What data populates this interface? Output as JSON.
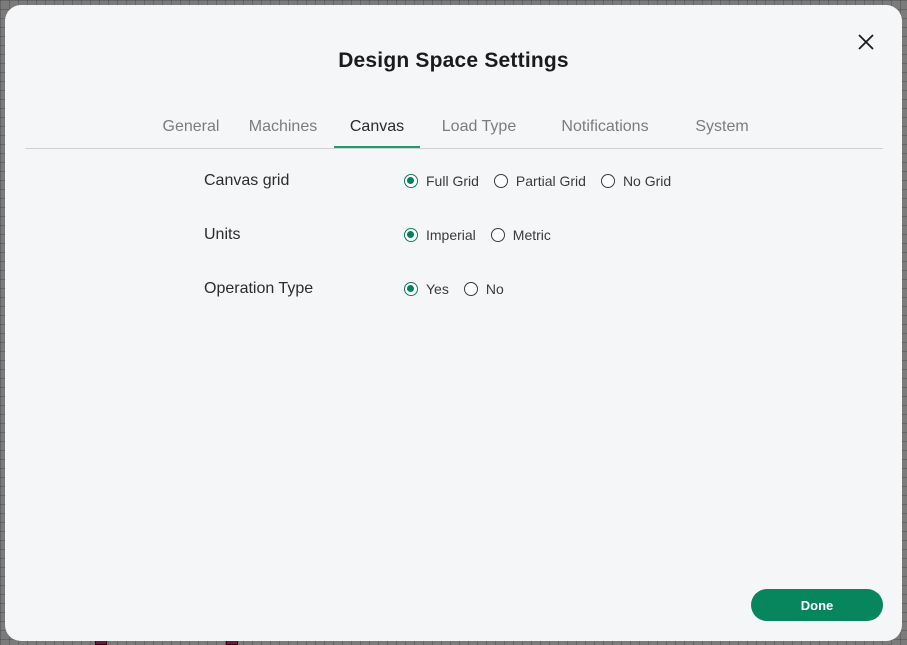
{
  "dialog": {
    "title": "Design Space Settings",
    "close_icon": "close-icon",
    "tabs": [
      {
        "label": "General",
        "active": false
      },
      {
        "label": "Machines",
        "active": false
      },
      {
        "label": "Canvas",
        "active": true
      },
      {
        "label": "Load Type",
        "active": false
      },
      {
        "label": "Notifications",
        "active": false
      },
      {
        "label": "System",
        "active": false
      }
    ],
    "settings": [
      {
        "label": "Canvas grid",
        "options": [
          {
            "label": "Full Grid",
            "checked": true
          },
          {
            "label": "Partial Grid",
            "checked": false
          },
          {
            "label": "No Grid",
            "checked": false
          }
        ]
      },
      {
        "label": "Units",
        "options": [
          {
            "label": "Imperial",
            "checked": true
          },
          {
            "label": "Metric",
            "checked": false
          }
        ]
      },
      {
        "label": "Operation Type",
        "options": [
          {
            "label": "Yes",
            "checked": true
          },
          {
            "label": "No",
            "checked": false
          }
        ]
      }
    ],
    "done_label": "Done"
  },
  "colors": {
    "accent": "#087f5b",
    "tab_underline": "#1e9b6d",
    "done_button": "#07855c",
    "modal_bg": "#f5f6f8",
    "backdrop": "#7a7b7a"
  }
}
